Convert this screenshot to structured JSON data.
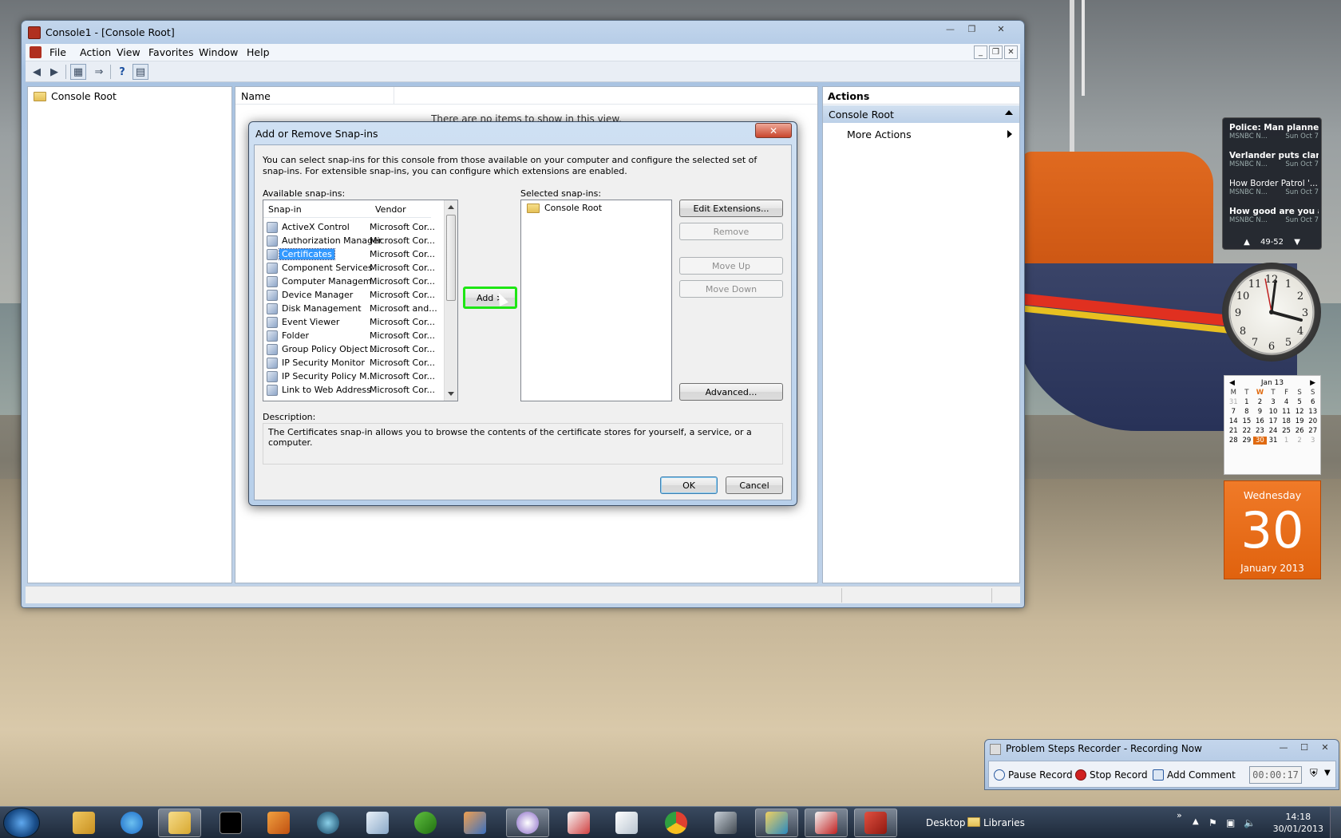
{
  "mmc": {
    "title": "Console1 - [Console Root]",
    "menu": [
      "File",
      "Action",
      "View",
      "Favorites",
      "Window",
      "Help"
    ],
    "tree_root": "Console Root",
    "column_name": "Name",
    "empty_message": "There are no items to show in this view.",
    "actions": {
      "title": "Actions",
      "group": "Console Root",
      "more": "More Actions"
    }
  },
  "dialog": {
    "title": "Add or Remove Snap-ins",
    "close_label": "✕",
    "intro": "You can select snap-ins for this console from those available on your computer and configure the selected set of snap-ins. For extensible snap-ins, you can configure which extensions are enabled.",
    "available_label": "Available snap-ins:",
    "selected_label": "Selected snap-ins:",
    "col_snapin": "Snap-in",
    "col_vendor": "Vendor",
    "snapins": [
      {
        "name": "ActiveX Control",
        "vendor": "Microsoft Cor..."
      },
      {
        "name": "Authorization Manager",
        "vendor": "Microsoft Cor..."
      },
      {
        "name": "Certificates",
        "vendor": "Microsoft Cor..."
      },
      {
        "name": "Component Services",
        "vendor": "Microsoft Cor..."
      },
      {
        "name": "Computer Managem...",
        "vendor": "Microsoft Cor..."
      },
      {
        "name": "Device Manager",
        "vendor": "Microsoft Cor..."
      },
      {
        "name": "Disk Management",
        "vendor": "Microsoft and..."
      },
      {
        "name": "Event Viewer",
        "vendor": "Microsoft Cor..."
      },
      {
        "name": "Folder",
        "vendor": "Microsoft Cor..."
      },
      {
        "name": "Group Policy Object ...",
        "vendor": "Microsoft Cor..."
      },
      {
        "name": "IP Security Monitor",
        "vendor": "Microsoft Cor..."
      },
      {
        "name": "IP Security Policy M...",
        "vendor": "Microsoft Cor..."
      },
      {
        "name": "Link to Web Address",
        "vendor": "Microsoft Cor..."
      }
    ],
    "selected_item": "Certificates",
    "selected_snapins": [
      "Console Root"
    ],
    "buttons": {
      "add": "Add >",
      "edit_extensions": "Edit Extensions...",
      "remove": "Remove",
      "move_up": "Move Up",
      "move_down": "Move Down",
      "advanced": "Advanced...",
      "ok": "OK",
      "cancel": "Cancel"
    },
    "description_label": "Description:",
    "description": "The Certificates snap-in allows you to browse the contents of the certificate stores for yourself, a service, or a computer."
  },
  "news": {
    "items": [
      {
        "headline": "Police: Man planned ...",
        "source": "MSNBC N...",
        "date": "Sun Oct 7"
      },
      {
        "headline": "Verlander puts clam...",
        "source": "MSNBC N...",
        "date": "Sun Oct 7"
      },
      {
        "headline": "How Border Patrol '...",
        "source": "MSNBC N...",
        "date": "Sun Oct 7"
      },
      {
        "headline": "How good are you at...",
        "source": "MSNBC N...",
        "date": "Sun Oct 7"
      }
    ],
    "pager": "49-52"
  },
  "calendar": {
    "month_header": "Jan 13",
    "day_heads": [
      "M",
      "T",
      "W",
      "T",
      "F",
      "S",
      "S"
    ],
    "days": [
      "31",
      "1",
      "2",
      "3",
      "4",
      "5",
      "6",
      "7",
      "8",
      "9",
      "10",
      "11",
      "12",
      "13",
      "14",
      "15",
      "16",
      "17",
      "18",
      "19",
      "20",
      "21",
      "22",
      "23",
      "24",
      "25",
      "26",
      "27",
      "28",
      "29",
      "30",
      "31",
      "1",
      "2",
      "3"
    ],
    "today": "30",
    "weekday": "Wednesday",
    "day_number": "30",
    "month_year": "January 2013"
  },
  "psr": {
    "title": "Problem Steps Recorder - Recording Now",
    "pause": "Pause Record",
    "stop": "Stop Record",
    "comment": "Add Comment",
    "timer": "00:00:17"
  },
  "taskbar": {
    "desktop_label": "Desktop",
    "libraries_label": "Libraries",
    "time": "14:18",
    "date": "30/01/2013"
  },
  "colors": {
    "add_highlight": "#1ee614",
    "selection": "#3399ff",
    "calendar_accent": "#e06a10"
  }
}
